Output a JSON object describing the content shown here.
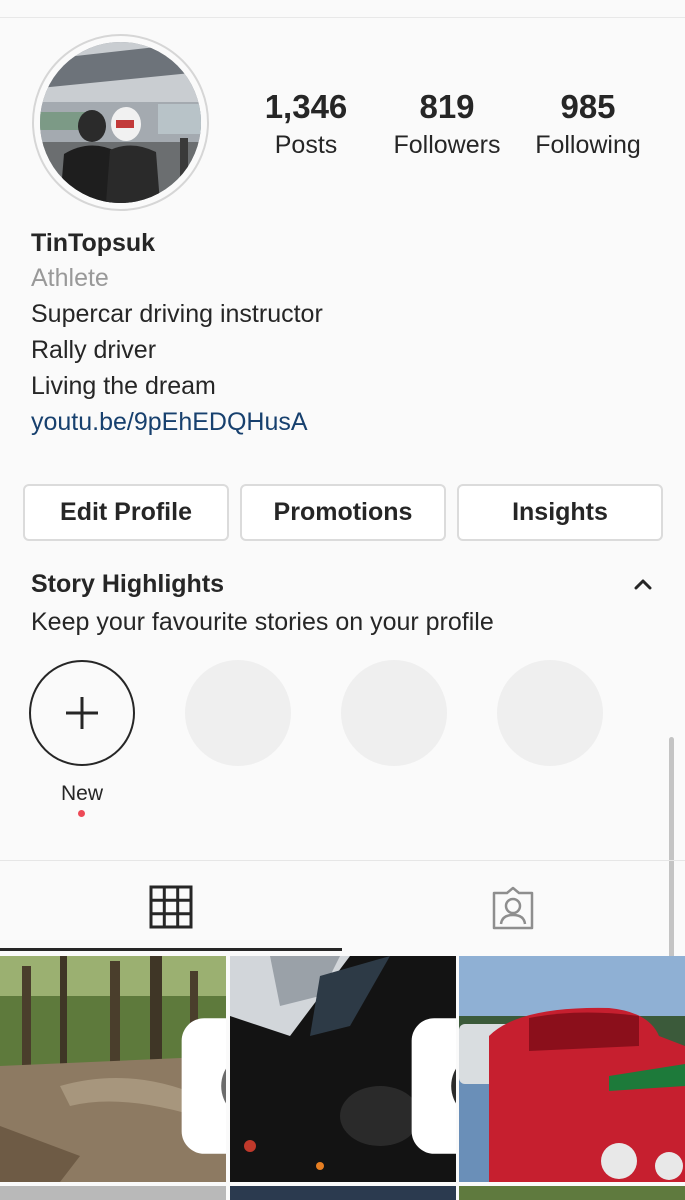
{
  "profile": {
    "username": "TinTopsuk",
    "category": "Athlete",
    "bio_lines": [
      "Supercar driving instructor",
      "Rally driver",
      "Living the dream"
    ],
    "link": "youtu.be/9pEhEDQHusA"
  },
  "stats": {
    "posts": {
      "value": "1,346",
      "label": "Posts"
    },
    "followers": {
      "value": "819",
      "label": "Followers"
    },
    "following": {
      "value": "985",
      "label": "Following"
    }
  },
  "buttons": {
    "edit_profile": "Edit Profile",
    "promotions": "Promotions",
    "insights": "Insights"
  },
  "highlights": {
    "title": "Story Highlights",
    "subtitle": "Keep your favourite stories on your profile",
    "new_label": "New"
  },
  "tabs": [
    {
      "icon": "grid-icon",
      "active": true
    },
    {
      "icon": "tagged-person-icon",
      "active": false
    }
  ],
  "icons": {
    "collapse": "chevron-up-icon",
    "add_highlight": "plus-icon",
    "video_badge": "video-camera-icon"
  },
  "colors": {
    "link": "#17406e",
    "muted": "#999999",
    "notification_dot": "#ed4956",
    "placeholder_circle": "#efefef",
    "border": "#dbdbdb"
  },
  "posts": [
    {
      "type": "video",
      "subject": "forest dirt track"
    },
    {
      "type": "video",
      "subject": "car interior at night"
    },
    {
      "type": "photo",
      "subject": "red classic car"
    }
  ]
}
